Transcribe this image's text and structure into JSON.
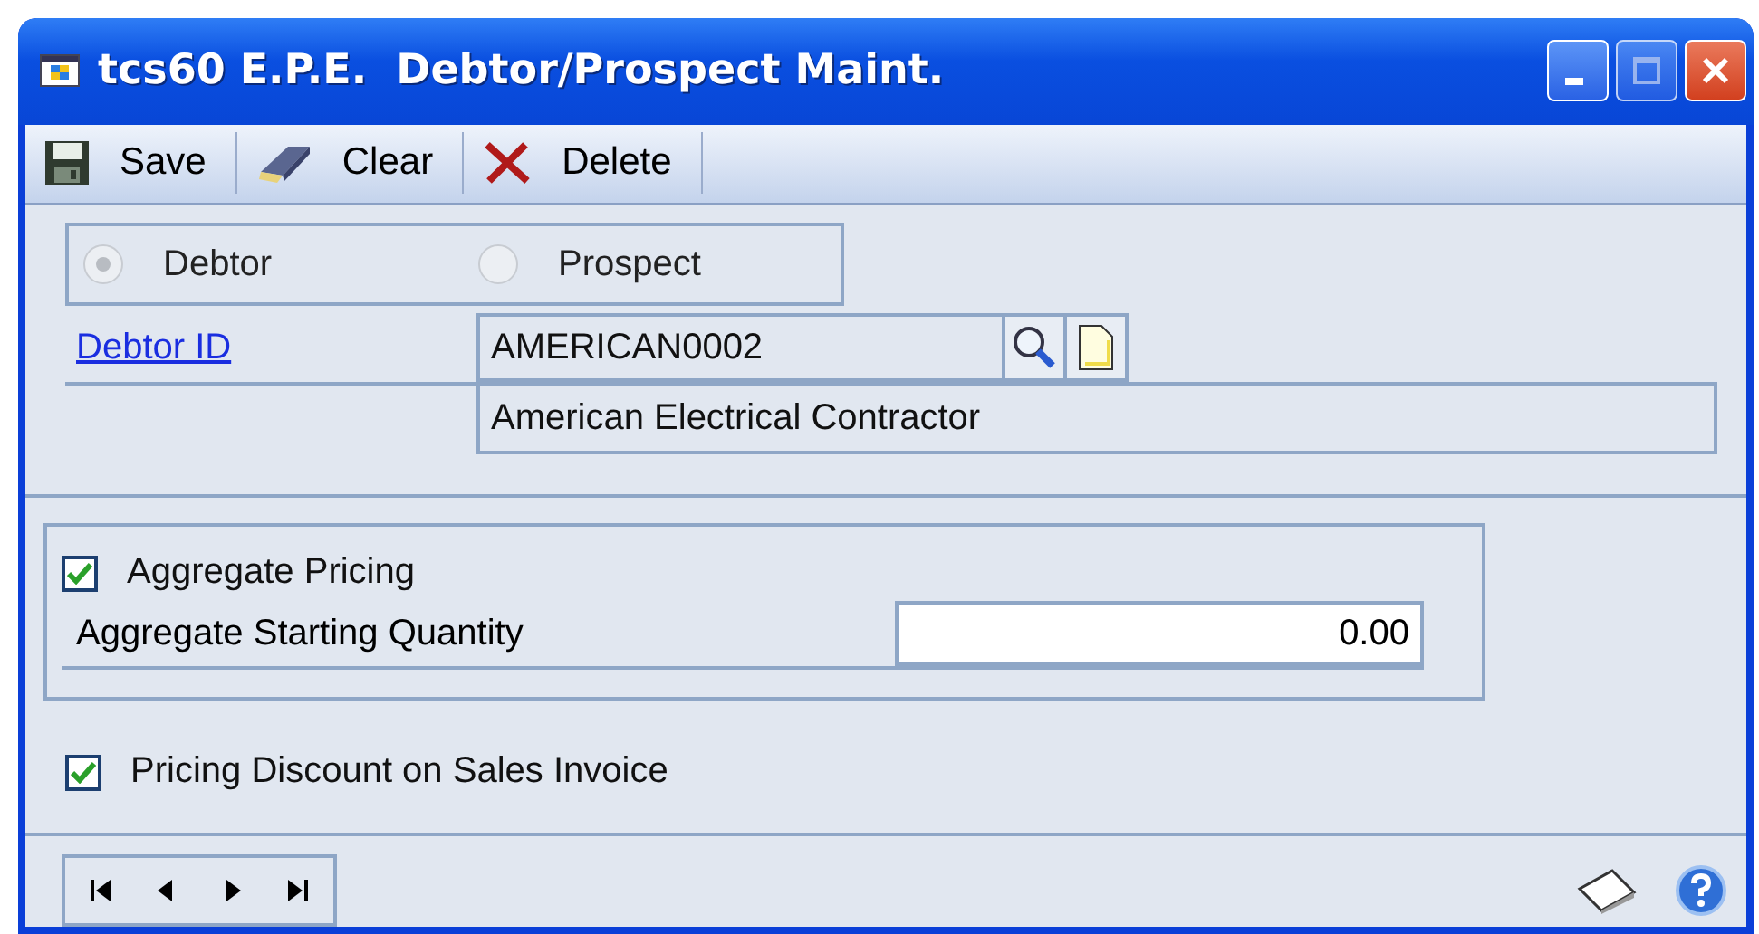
{
  "window": {
    "title": "tcs60 E.P.E.  Debtor/Prospect Maint."
  },
  "toolbar": [
    {
      "label": "Save",
      "kind": "save"
    },
    {
      "label": "Clear",
      "kind": "clear"
    },
    {
      "label": "Delete",
      "kind": "delete"
    }
  ],
  "type_options": [
    {
      "label": "Debtor",
      "selected": true
    },
    {
      "label": "Prospect",
      "selected": false
    }
  ],
  "debtor_id": {
    "label": "Debtor ID",
    "value": "AMERICAN0002",
    "name": "American Electrical Contractor"
  },
  "aggregate_pricing": {
    "label": "Aggregate Pricing",
    "checked": true
  },
  "aggregate_starting_quantity": {
    "label": "Aggregate Starting Quantity",
    "value": "0.00"
  },
  "pricing_discount": {
    "label": "Pricing Discount on Sales Invoice",
    "checked": true
  }
}
